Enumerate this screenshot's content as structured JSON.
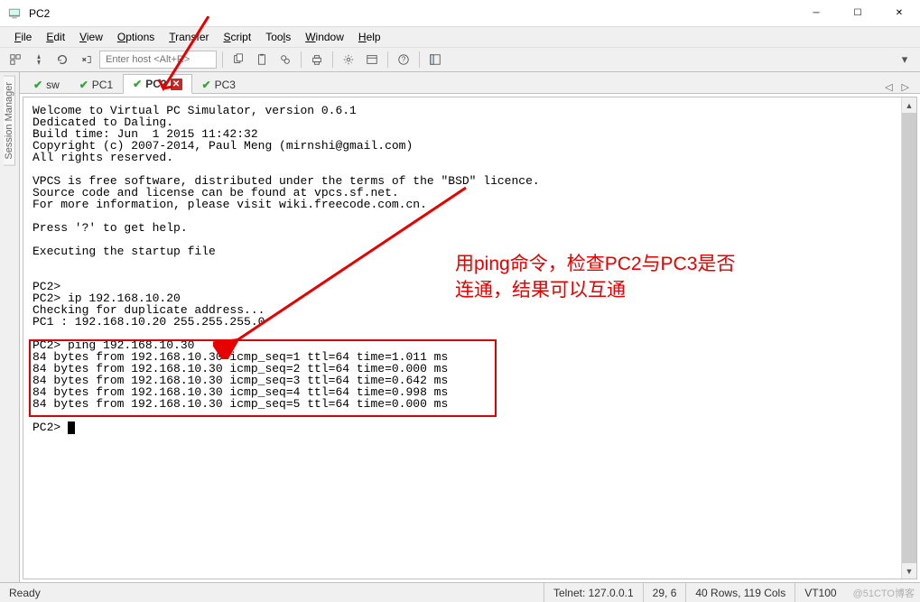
{
  "window": {
    "title": "PC2"
  },
  "menu": {
    "items": [
      "File",
      "Edit",
      "View",
      "Options",
      "Transfer",
      "Script",
      "Tools",
      "Window",
      "Help"
    ]
  },
  "toolbar": {
    "quickconnect_placeholder": "Enter host <Alt+R>"
  },
  "sidetab": {
    "label": "Session Manager"
  },
  "tabs": {
    "items": [
      {
        "label": "sw",
        "status": "ok"
      },
      {
        "label": "PC1",
        "status": "ok"
      },
      {
        "label": "PC2",
        "status": "ok",
        "active": true,
        "closable": true
      },
      {
        "label": "PC3",
        "status": "ok"
      }
    ]
  },
  "terminal": {
    "lines": [
      "Welcome to Virtual PC Simulator, version 0.6.1",
      "Dedicated to Daling.",
      "Build time: Jun  1 2015 11:42:32",
      "Copyright (c) 2007-2014, Paul Meng (mirnshi@gmail.com)",
      "All rights reserved.",
      "",
      "VPCS is free software, distributed under the terms of the \"BSD\" licence.",
      "Source code and license can be found at vpcs.sf.net.",
      "For more information, please visit wiki.freecode.com.cn.",
      "",
      "Press '?' to get help.",
      "",
      "Executing the startup file",
      "",
      "",
      "PC2>",
      "PC2> ip 192.168.10.20",
      "Checking for duplicate address...",
      "PC1 : 192.168.10.20 255.255.255.0",
      "",
      "PC2> ping 192.168.10.30",
      "84 bytes from 192.168.10.30 icmp_seq=1 ttl=64 time=1.011 ms",
      "84 bytes from 192.168.10.30 icmp_seq=2 ttl=64 time=0.000 ms",
      "84 bytes from 192.168.10.30 icmp_seq=3 ttl=64 time=0.642 ms",
      "84 bytes from 192.168.10.30 icmp_seq=4 ttl=64 time=0.998 ms",
      "84 bytes from 192.168.10.30 icmp_seq=5 ttl=64 time=0.000 ms",
      "",
      "PC2> "
    ]
  },
  "annotation": {
    "line1": "用ping命令，检查PC2与PC3是否",
    "line2": "连通，结果可以互通"
  },
  "status": {
    "ready": "Ready",
    "conn": "Telnet: 127.0.0.1",
    "pos": "29,  6",
    "size": "40 Rows, 119 Cols",
    "term": "VT100",
    "watermark": "@51CTO博客"
  }
}
